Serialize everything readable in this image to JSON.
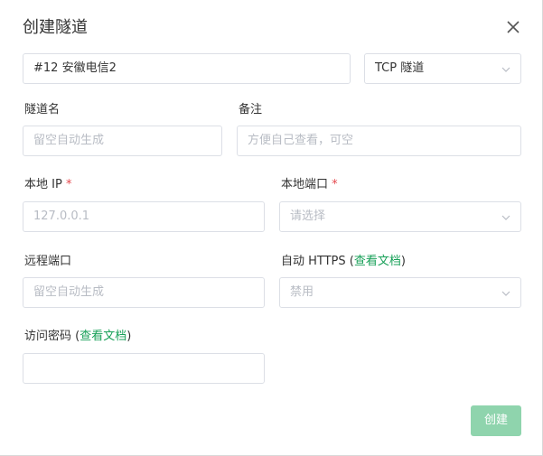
{
  "dialog": {
    "title": "创建隧道",
    "node_select": {
      "value": "#12 安徽电信2"
    },
    "type_select": {
      "value": "TCP 隧道"
    },
    "tunnel_name": {
      "label": "隧道名",
      "placeholder": "留空自动生成"
    },
    "remark": {
      "label": "备注",
      "placeholder": "方便自己查看，可空"
    },
    "local_ip": {
      "label": "本地 IP",
      "required_mark": "*",
      "placeholder": "127.0.0.1"
    },
    "local_port": {
      "label": "本地端口",
      "required_mark": "*",
      "placeholder": "请选择"
    },
    "remote_port": {
      "label": "远程端口",
      "placeholder": "留空自动生成"
    },
    "auto_https": {
      "label": "自动 HTTPS",
      "doc_open": "(",
      "doc_link": "查看文档",
      "doc_close": ")",
      "value": "禁用"
    },
    "access_password": {
      "label": "访问密码",
      "doc_open": "(",
      "doc_link": "查看文档",
      "doc_close": ")",
      "value": ""
    },
    "create_button": "创建"
  },
  "colors": {
    "accent": "#18a058",
    "button_disabled": "#8fd4ad",
    "required": "#e5484d",
    "border": "#dcdfe6"
  },
  "icons": {
    "close": "close-icon",
    "chevron": "chevron-down-icon"
  }
}
